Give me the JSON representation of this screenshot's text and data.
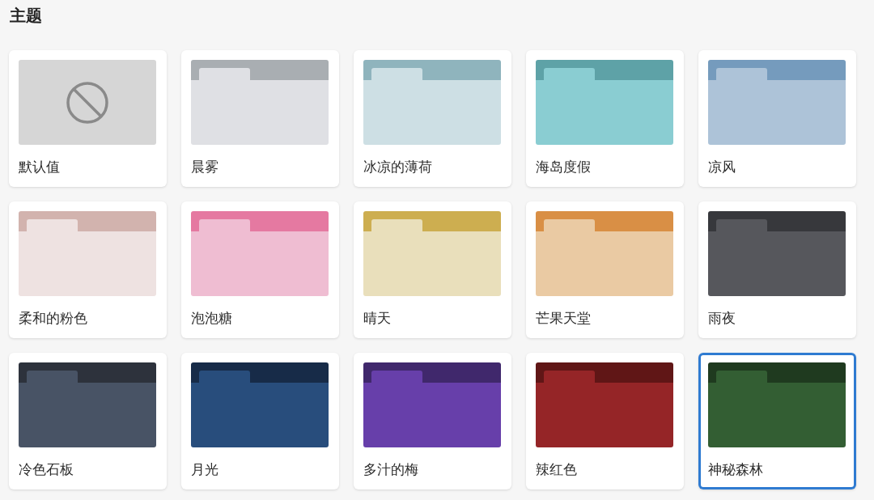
{
  "title": "主题",
  "themes": [
    {
      "name": "默认值",
      "kind": "none",
      "selected": false
    },
    {
      "name": "晨雾",
      "kind": "folder",
      "frame": {
        "color": "#a9aeb2"
      },
      "color": "#dfe0e4",
      "selected": false
    },
    {
      "name": "冰凉的薄荷",
      "kind": "folder",
      "frame": {
        "color": "#8fb4bd"
      },
      "color": "#cddfe4",
      "selected": false
    },
    {
      "name": "海岛度假",
      "kind": "folder",
      "frame": {
        "color": "#5ea2a7"
      },
      "color": "#8acdd2",
      "selected": false
    },
    {
      "name": "凉风",
      "kind": "folder",
      "frame": {
        "color": "#759bbd"
      },
      "color": "#adc3d8",
      "selected": false
    },
    {
      "name": "柔和的粉色",
      "kind": "folder",
      "frame": {
        "color": "#d2b3ae"
      },
      "color": "#eee2e1",
      "selected": false
    },
    {
      "name": "泡泡糖",
      "kind": "folder",
      "frame": {
        "color": "#e579a1"
      },
      "color": "#efbdd2",
      "selected": false
    },
    {
      "name": "晴天",
      "kind": "folder",
      "frame": {
        "color": "#cdae50"
      },
      "color": "#e9dfbb",
      "selected": false
    },
    {
      "name": "芒果天堂",
      "kind": "folder",
      "frame": {
        "color": "#d98f45"
      },
      "color": "#eacaa3",
      "selected": false
    },
    {
      "name": "雨夜",
      "kind": "folder",
      "frame": {
        "color": "#37383c"
      },
      "color": "#56575c",
      "selected": false
    },
    {
      "name": "冷色石板",
      "kind": "folder",
      "frame": {
        "color": "#2d323c"
      },
      "color": "#485365",
      "selected": false
    },
    {
      "name": "月光",
      "kind": "folder",
      "frame": {
        "color": "#172b48"
      },
      "color": "#284d7c",
      "selected": false
    },
    {
      "name": "多汁的梅",
      "kind": "folder",
      "frame": {
        "color": "#40286c"
      },
      "color": "#673faa",
      "selected": false
    },
    {
      "name": "辣红色",
      "kind": "folder",
      "frame": {
        "color": "#601616"
      },
      "color": "#952527",
      "selected": false
    },
    {
      "name": "神秘森林",
      "kind": "folder",
      "frame": {
        "color": "#1f3a1f"
      },
      "color": "#335e33",
      "selected": true
    }
  ]
}
